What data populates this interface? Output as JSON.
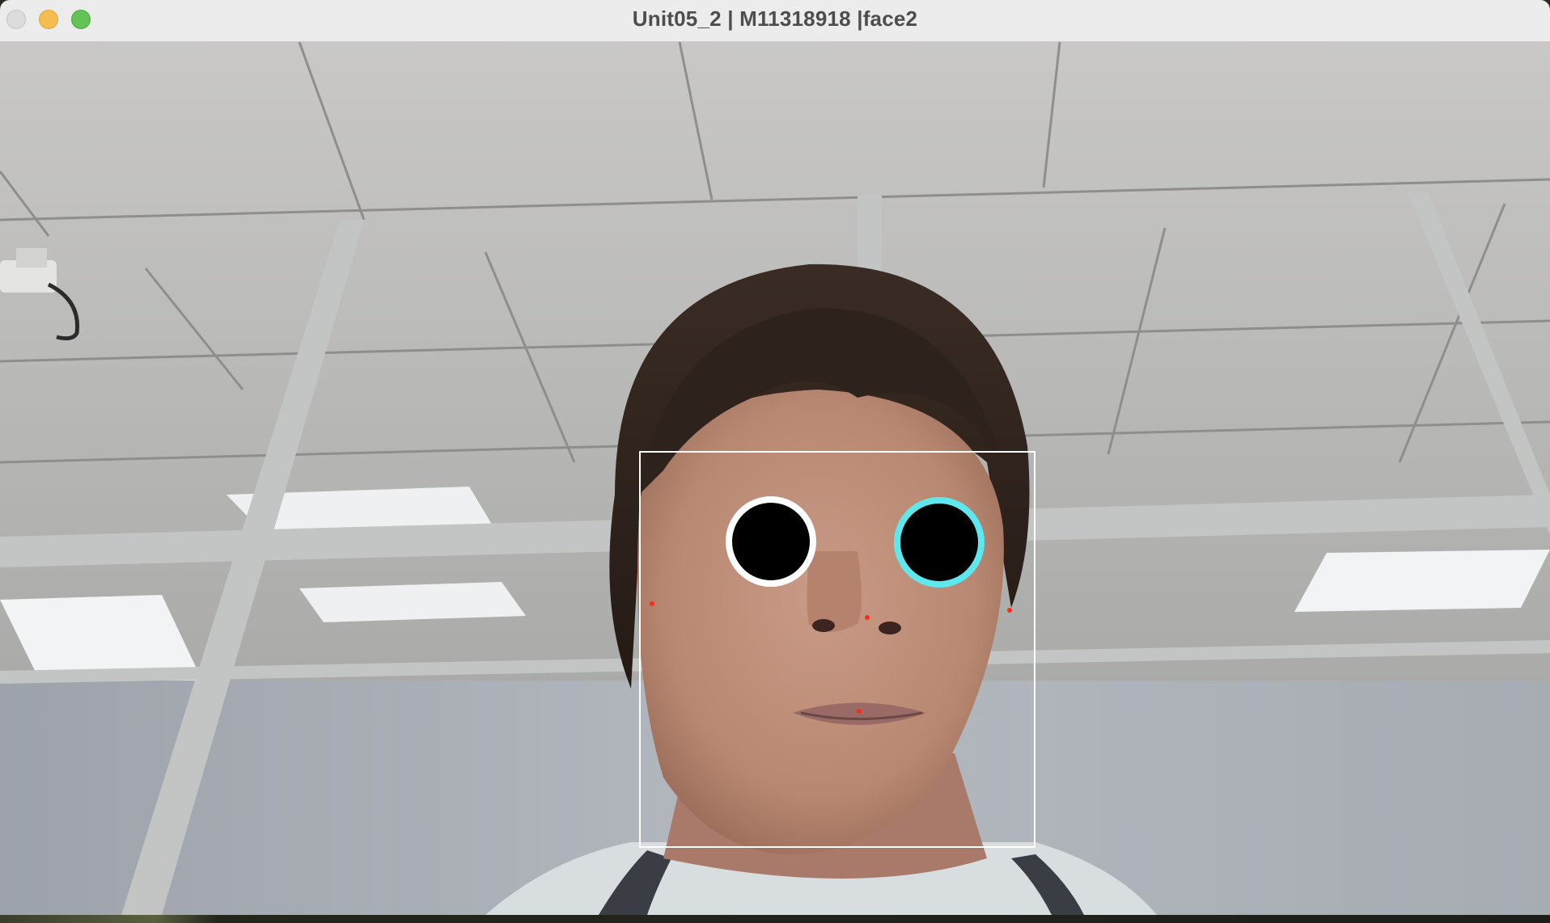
{
  "window": {
    "title": "Unit05_2 | M11318918 |face2",
    "controls": {
      "close": "close-button",
      "minimize": "minimize-button",
      "maximize": "maximize-button"
    }
  },
  "overlay": {
    "face_box_color": "#ffffff",
    "right_eye_ring_color": "#ffffff",
    "left_eye_ring_color": "#5ee8ee",
    "eye_fill_color": "#000000",
    "landmark_color": "#ff2a1a"
  }
}
